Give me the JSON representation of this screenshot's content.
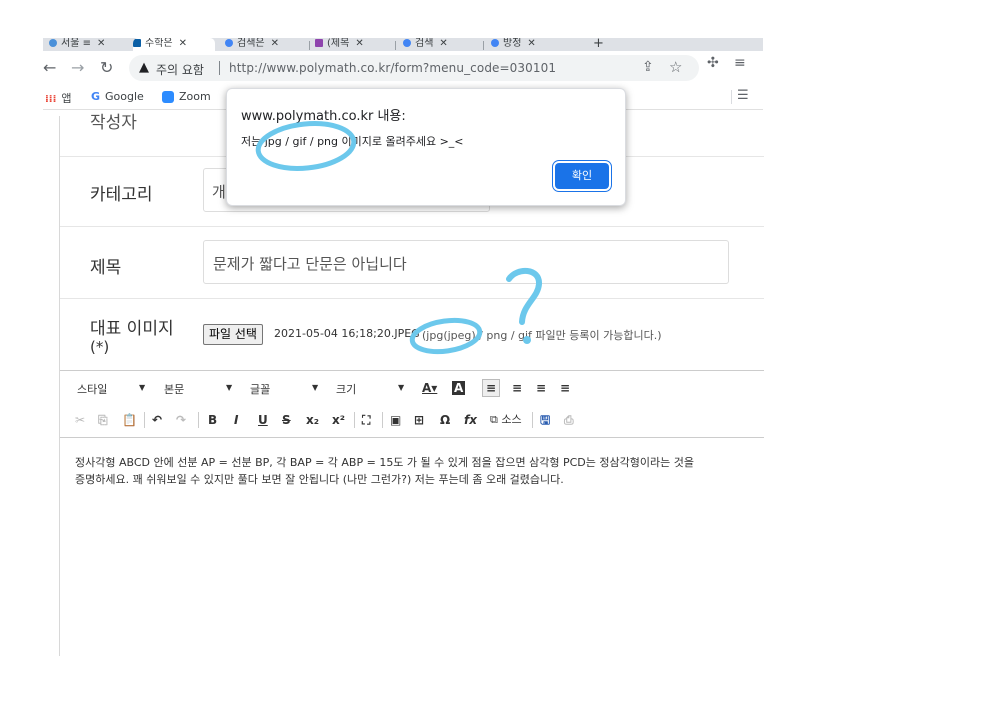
{
  "browser": {
    "tabs": [
      {
        "label": "서울 ≡",
        "active": false
      },
      {
        "label": "수학은",
        "active": true
      },
      {
        "label": "검색은",
        "active": false
      },
      {
        "label": "(제목",
        "active": false
      },
      {
        "label": "검색",
        "active": false
      },
      {
        "label": "방정",
        "active": false
      }
    ],
    "security_label": "주의 요함",
    "url": "http://www.polymath.co.kr/form?menu_code=030101",
    "bookmarks": [
      {
        "icon": "apps-grid-icon",
        "label": "앱"
      },
      {
        "icon": "google-icon",
        "label": "Google"
      },
      {
        "icon": "zoom-icon",
        "label": "Zoom"
      }
    ]
  },
  "form": {
    "row_writer_label": "작성자",
    "category_label": "카테고리",
    "category_value": "개",
    "title_label": "제목",
    "title_value": "문제가 짧다고 단문은 아닙니다",
    "image_label_line1": "대표 이미지",
    "image_label_line2": "(*)",
    "file_button": "파일 선택",
    "file_name": "2021-05-04 16;18;20.JPEG",
    "file_hint": "(jpg(jpeg) / png / gif 파일만 등록이 가능합니다.)"
  },
  "editor": {
    "combos": [
      "스타일",
      "본문",
      "글꼴",
      "크기"
    ],
    "source_label": "소스",
    "body_lines": [
      "정사각형 ABCD 안에 선분 AP = 선분 BP, 각 BAP = 각 ABP = 15도 가 될 수 있게 점을 잡으면 삼각형 PCD는 정삼각형이라는 것을",
      "증명하세요. 꽤 쉬워보일 수 있지만 풀다 보면 잘 안됩니다 (나만 그런가?) 저는 푸는데 좀 오래 걸렸습니다."
    ]
  },
  "dialog": {
    "title": "www.polymath.co.kr 내용:",
    "message": "저는 jpg / gif / png 이미지로 올려주세요 >_<",
    "ok_label": "확인"
  },
  "annotation": {
    "mark": "?",
    "color": "#6cc8ec"
  }
}
